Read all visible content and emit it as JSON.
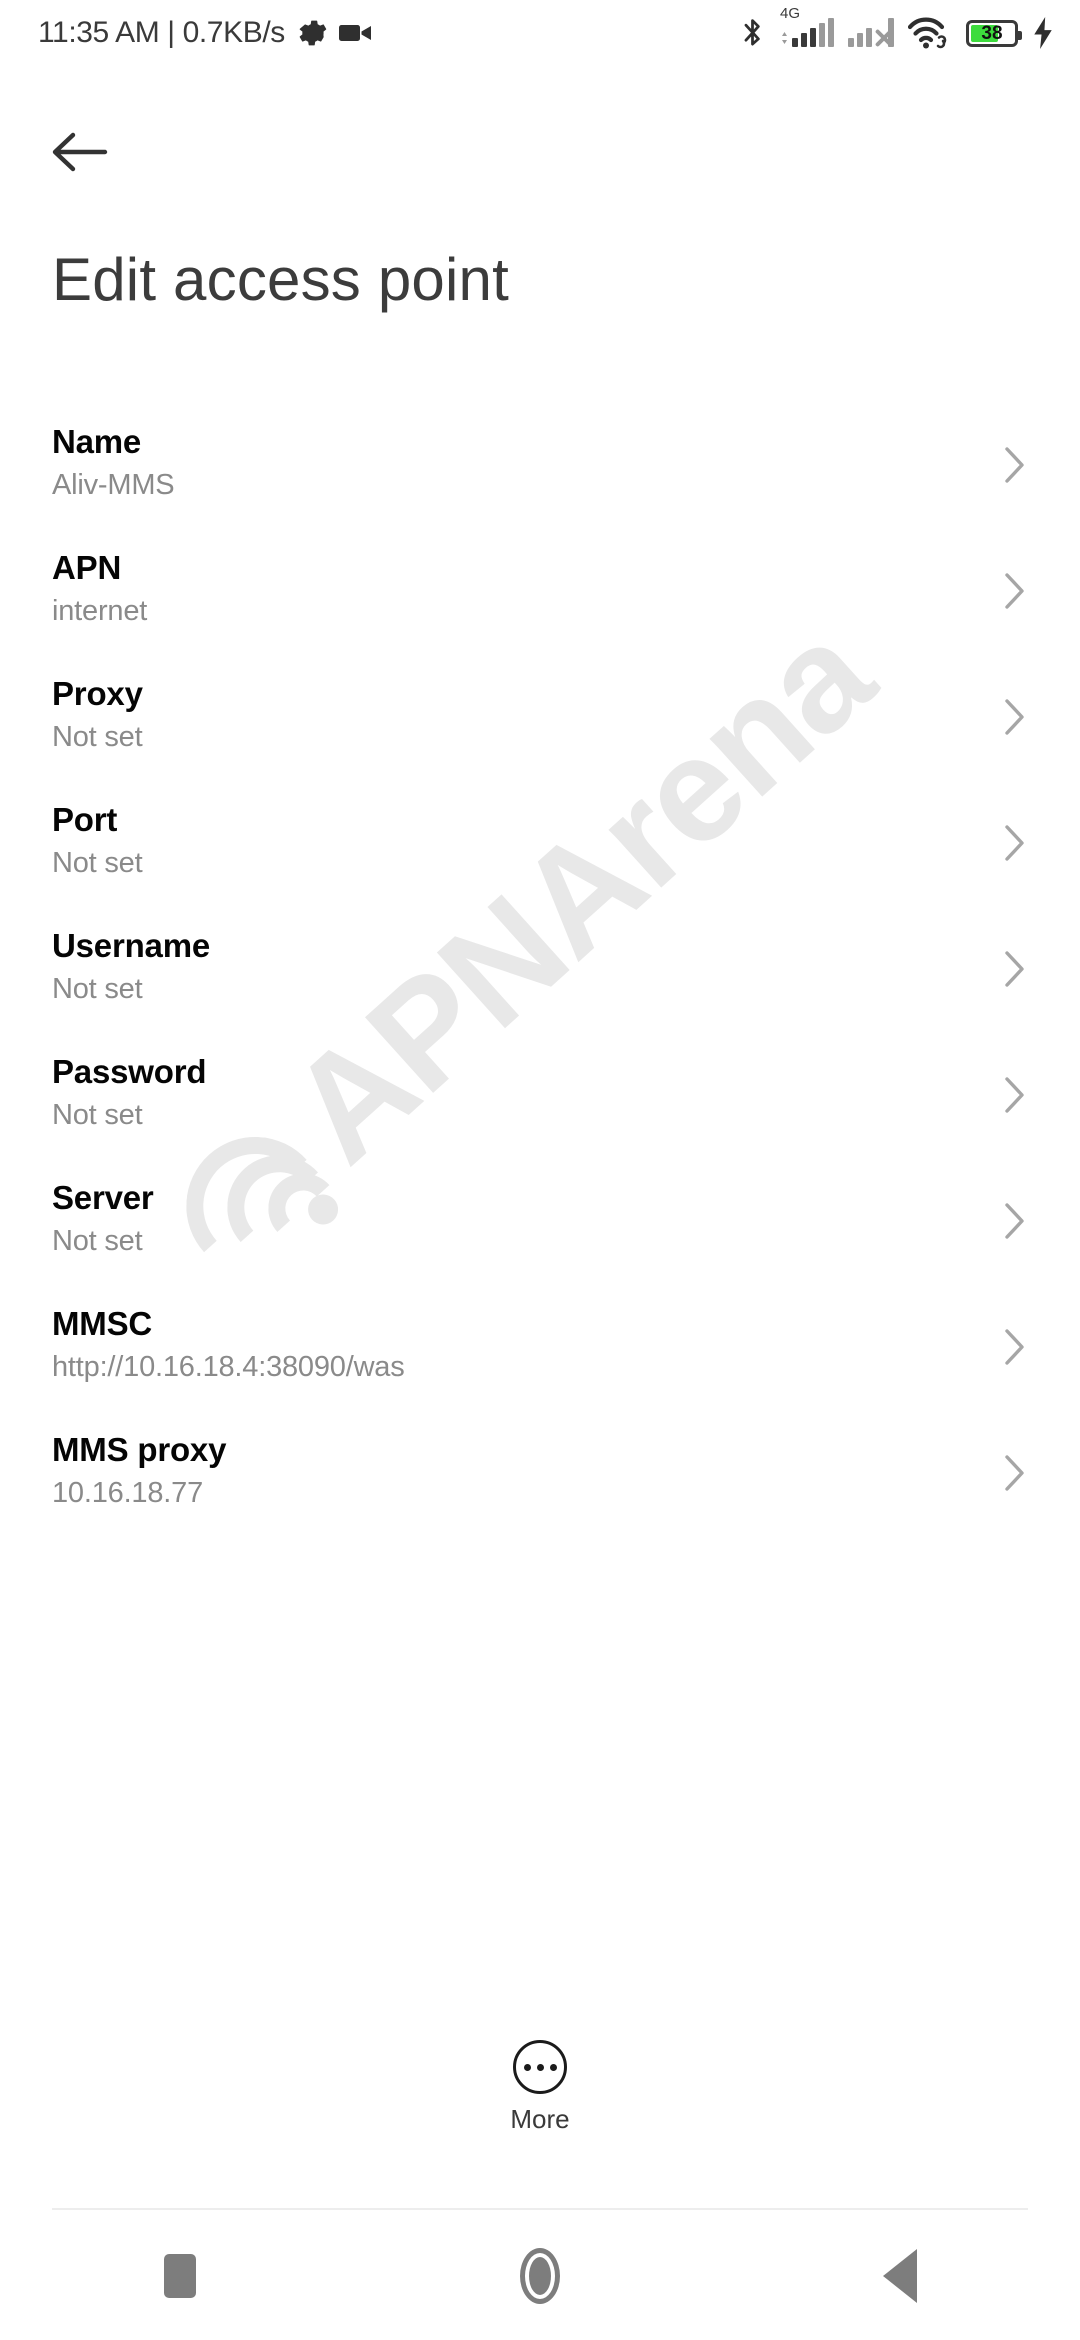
{
  "status_bar": {
    "clock": "11:35 AM | 0.7KB/s",
    "gear_icon": "gear-icon",
    "video_icon": "video-camera-icon",
    "bluetooth_icon": "bluetooth-icon",
    "network_type": "4G",
    "sim1_icon": "signal-bars-sim1-icon",
    "sim2_icon": "signal-bars-sim2-no-service-icon",
    "wifi_icon": "wifi-linked-icon",
    "battery_level": "38",
    "battery_icon": "battery-icon",
    "charging_icon": "charging-bolt-icon",
    "battery_color": "#3ddc3d"
  },
  "header": {
    "back_icon": "back-arrow-icon",
    "title": "Edit access point"
  },
  "watermark": {
    "text": "APNArena",
    "logo_icon": "wifi-signal-logo-icon",
    "color": "#e8e8e8"
  },
  "settings": {
    "rows": [
      {
        "title": "Name",
        "value": "Aliv-MMS"
      },
      {
        "title": "APN",
        "value": "internet"
      },
      {
        "title": "Proxy",
        "value": "Not set"
      },
      {
        "title": "Port",
        "value": "Not set"
      },
      {
        "title": "Username",
        "value": "Not set"
      },
      {
        "title": "Password",
        "value": "Not set"
      },
      {
        "title": "Server",
        "value": "Not set"
      },
      {
        "title": "MMSC",
        "value": "http://10.16.18.4:38090/was"
      },
      {
        "title": "MMS proxy",
        "value": "10.16.18.77"
      }
    ],
    "chevron_icon": "chevron-right-icon"
  },
  "more_button": {
    "label": "More",
    "icon": "more-dots-circle-icon"
  },
  "nav_bar": {
    "recents_icon": "recents-square-icon",
    "home_icon": "home-circle-icon",
    "back_icon": "back-triangle-icon",
    "color": "#7d7d7d"
  }
}
